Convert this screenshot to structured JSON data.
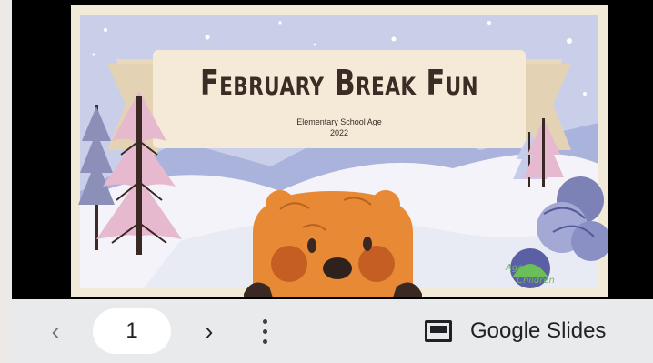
{
  "slide": {
    "title": "February Break Fun",
    "subtitle": "Elementary School Age",
    "year": "2022",
    "logo_text": "Agape Children"
  },
  "controls": {
    "prev_icon": "chevron-left-icon",
    "page_number": "1",
    "next_icon": "chevron-right-icon",
    "more_icon": "more-vertical-icon",
    "brand_icon": "google-slides-icon",
    "brand_label": "Google Slides"
  },
  "colors": {
    "sky": "#c9cfe9",
    "snow": "#f7f7fb",
    "banner": "#f4ead7",
    "tree_pink": "#e6b9cf",
    "beaver": "#e88a35",
    "control_bar": "#e9eaec"
  }
}
